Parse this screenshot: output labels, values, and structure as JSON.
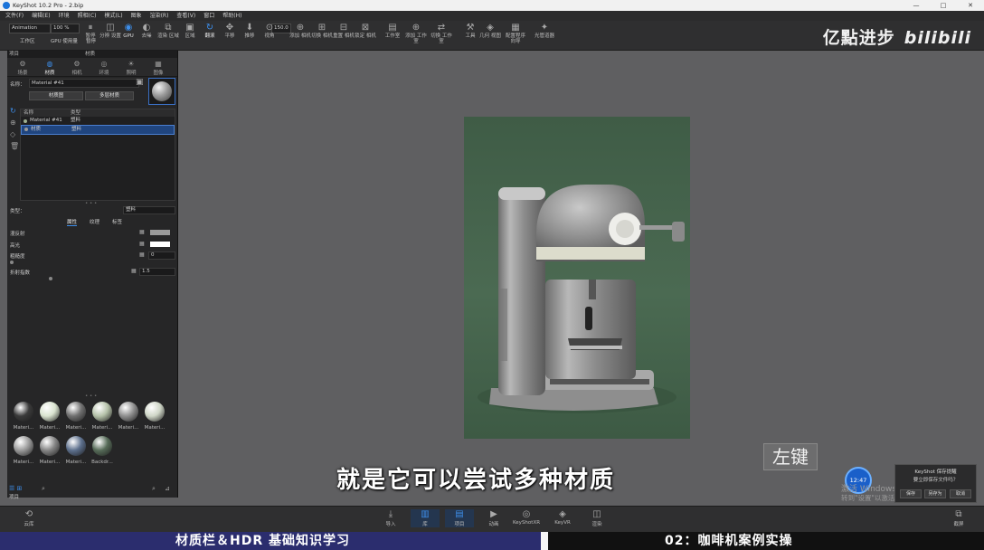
{
  "window": {
    "title": "KeyShot 10.2 Pro - 2.bip",
    "controls": [
      "—",
      "□",
      "✕"
    ]
  },
  "menu": [
    "文件(F)",
    "编辑(E)",
    "环境",
    "照相(C)",
    "模式(L)",
    "图象",
    "渲染(R)",
    "查看(V)",
    "窗口",
    "帮助(H)"
  ],
  "toolbar": {
    "mode_select": "Animation",
    "zoom_select": "100 %",
    "fps_value": "150.0",
    "workspace_label": "工作区",
    "gpu_label": "GPU 使用量",
    "pause_label": "暂停",
    "items": [
      {
        "icon": "⏸",
        "label": "暂停"
      },
      {
        "icon": "◫",
        "label": "分辨 设置"
      },
      {
        "icon": "◉",
        "label": "GPU",
        "active": true
      },
      {
        "icon": "◐",
        "label": "去噪"
      },
      {
        "icon": "⧉",
        "label": "渲染 区域"
      },
      {
        "icon": "▣",
        "label": "区域"
      },
      {
        "icon": "↻",
        "label": "翻滚",
        "active": true
      },
      {
        "icon": "✥",
        "label": "平移"
      },
      {
        "icon": "⬇",
        "label": "推移"
      },
      {
        "icon": "⊙",
        "label": "视角"
      },
      {
        "icon": "⊕",
        "label": "添加 相机"
      },
      {
        "icon": "⊞",
        "label": "切换 相机"
      },
      {
        "icon": "⊟",
        "label": "重置 相机"
      },
      {
        "icon": "⊠",
        "label": "锁定 相机"
      },
      {
        "icon": "▤",
        "label": "工作室"
      },
      {
        "icon": "⊕",
        "label": "添加 工作室"
      },
      {
        "icon": "⇄",
        "label": "切换 工作室"
      },
      {
        "icon": "⚒",
        "label": "工具"
      },
      {
        "icon": "◈",
        "label": "几何 视图"
      },
      {
        "icon": "▦",
        "label": "配置程序 向导"
      },
      {
        "icon": "✦",
        "label": "光管道器"
      }
    ]
  },
  "brand": {
    "text": "亿點进步",
    "logo": "bilibili"
  },
  "left_panel": {
    "header": "项目",
    "header_tab": "材质",
    "tabs": [
      {
        "icon": "⚙",
        "label": "场景"
      },
      {
        "icon": "◍",
        "label": "材质",
        "active": true
      },
      {
        "icon": "⚙",
        "label": "相机"
      },
      {
        "icon": "◎",
        "label": "环境"
      },
      {
        "icon": "☀",
        "label": "照明"
      },
      {
        "icon": "▦",
        "label": "图像"
      }
    ],
    "name_label": "名称：",
    "name_value": "Material #41",
    "btn_material_graph": "材质图",
    "btn_multi_material": "多层材质",
    "table": {
      "col_name": "名称",
      "col_type": "类型",
      "rows": [
        {
          "name": "Material #41",
          "type": "塑料"
        },
        {
          "name": "材质",
          "type": "塑料",
          "selected": true
        }
      ]
    },
    "type_label": "类型：",
    "type_value": "塑料",
    "prop_tabs": [
      "属性",
      "纹理",
      "标签"
    ],
    "properties": [
      {
        "label": "漫反射",
        "value": ""
      },
      {
        "label": "高光",
        "value": ""
      },
      {
        "label": "粗糙度",
        "value": "0"
      },
      {
        "label": "折射指数",
        "value": "1.5"
      }
    ],
    "colors": {
      "diffuse": "#9a9a9a",
      "specular": "#ffffff"
    },
    "library": [
      {
        "label": "Materi...",
        "color": "#3a3a3a"
      },
      {
        "label": "Materi...",
        "color": "#d9e3cf"
      },
      {
        "label": "Materi...",
        "color": "#707070"
      },
      {
        "label": "Materi...",
        "color": "#b5c2a9"
      },
      {
        "label": "Materi...",
        "color": "#8f8f8f"
      },
      {
        "label": "Materi...",
        "color": "#cfd6c7"
      },
      {
        "label": "Materi...",
        "color": "#9a9a9a"
      },
      {
        "label": "Materi...",
        "color": "#858585"
      },
      {
        "label": "Materi...",
        "color": "#5c6f8c"
      },
      {
        "label": "Backdr...",
        "color": "#566b58"
      }
    ],
    "footer_tab": "项目"
  },
  "bottom_bar": {
    "items": [
      {
        "icon": "⟲",
        "label": "云库"
      },
      {
        "icon": "⤓",
        "label": "导入"
      },
      {
        "icon": "▥",
        "label": "库",
        "active": true
      },
      {
        "icon": "▤",
        "label": "项目",
        "active": true
      },
      {
        "icon": "▶",
        "label": "动画"
      },
      {
        "icon": "◎",
        "label": "KeyShotXR"
      },
      {
        "icon": "◈",
        "label": "KeyVR"
      },
      {
        "icon": "◫",
        "label": "渲染"
      },
      {
        "icon": "⧉",
        "label": "截屏"
      }
    ]
  },
  "overlay": {
    "subtitle": "就是它可以尝试多种材质",
    "key_hint": "左键",
    "dialog_title": "KeyShot 保存提醒",
    "dialog_text": "要立即保存文件吗？",
    "dialog_buttons": [
      "保存",
      "另存为",
      "取消"
    ],
    "clock": "12:47",
    "watermark_1": "激活 Windows",
    "watermark_2": "转到\"设置\"以激活 Windows。"
  },
  "banner": {
    "left": "材质栏＆HDR 基础知识学习",
    "right": "02：咖啡机案例实操"
  }
}
